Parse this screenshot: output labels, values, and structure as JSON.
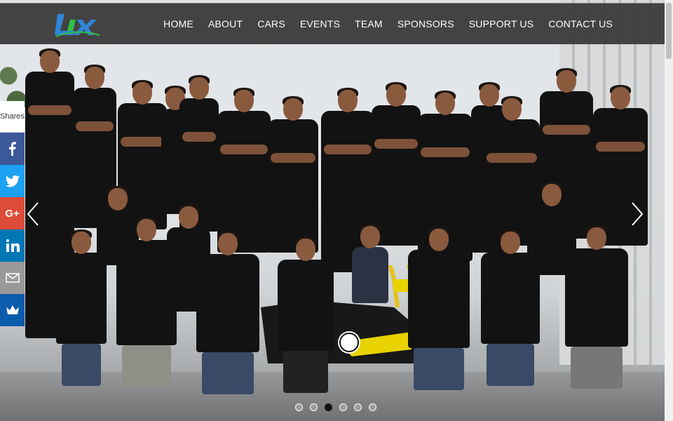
{
  "nav": {
    "items": [
      "HOME",
      "ABOUT",
      "CARS",
      "EVENTS",
      "TEAM",
      "SPONSORS",
      "SUPPORT US",
      "CONTACT US"
    ]
  },
  "share": {
    "label": "Shares",
    "buttons": [
      {
        "name": "facebook",
        "icon": "facebook-icon",
        "color": "#3b5998"
      },
      {
        "name": "twitter",
        "icon": "twitter-icon",
        "color": "#1da1f2"
      },
      {
        "name": "googleplus",
        "icon": "google-plus-icon",
        "color": "#dd4b39"
      },
      {
        "name": "linkedin",
        "icon": "linkedin-icon",
        "color": "#0077b5"
      },
      {
        "name": "email",
        "icon": "email-icon",
        "color": "#999999"
      },
      {
        "name": "sumo",
        "icon": "crown-icon",
        "color": "#0b5cad"
      }
    ]
  },
  "carousel": {
    "slide_count": 6,
    "active_index": 2
  },
  "colors": {
    "navbar_bg": "#373737",
    "nav_text": "#ffffff",
    "jersey": "#121212",
    "jersey_accent": "#e8d300"
  }
}
